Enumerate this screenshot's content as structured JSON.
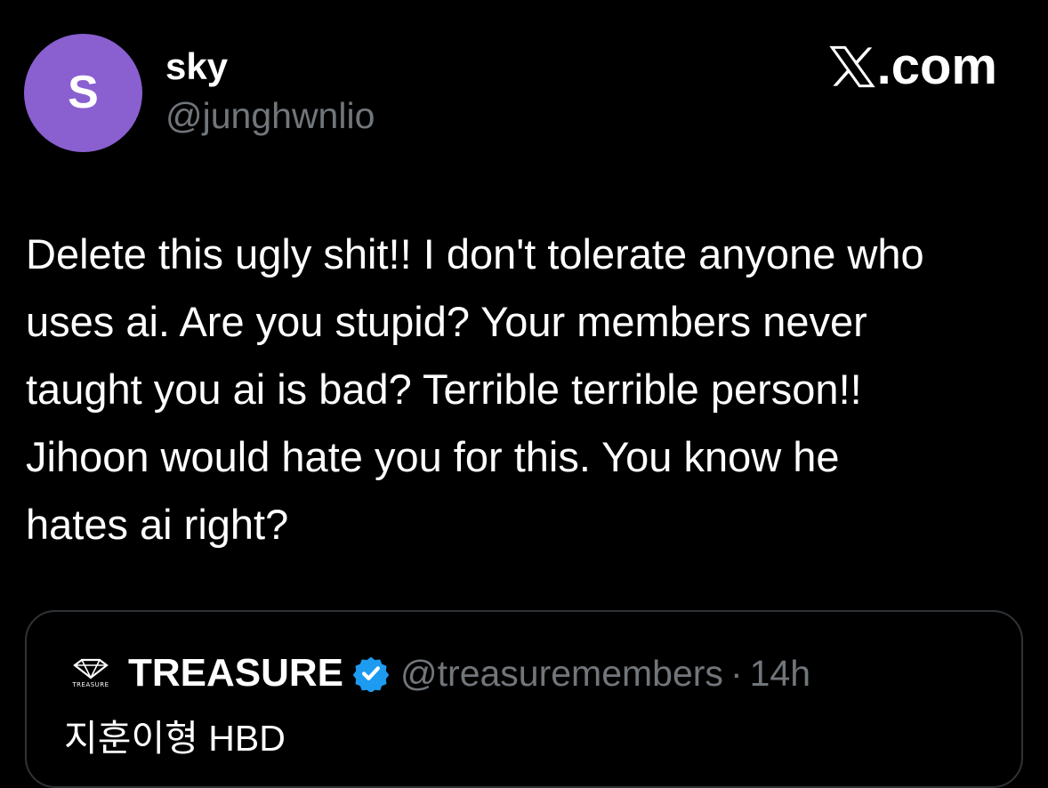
{
  "author": {
    "avatar_letter": "S",
    "avatar_color": "#8a5fd0",
    "display_name": "sky",
    "handle": "@junghwnlio"
  },
  "brand": {
    "icon": "x-logo-icon",
    "suffix": ".com"
  },
  "tweet": {
    "text": "Delete this ugly shit!! I don't tolerate anyone who\nuses ai. Are you stupid? Your members never\ntaught you ai is bad? Terrible terrible person!!\nJihoon would hate you for this. You know he\nhates ai right?"
  },
  "quote": {
    "logo_icon": "treasure-logo-icon",
    "logo_text": "TREASURE",
    "name": "TREASURE",
    "verified_icon": "verified-badge-icon",
    "verified_color": "#1d9bf0",
    "handle": "@treasuremembers",
    "separator": "·",
    "time": "14h",
    "text": "지훈이형 HBD"
  },
  "colors": {
    "background": "#000000",
    "secondary_text": "#71767b",
    "border": "#2f3336"
  }
}
